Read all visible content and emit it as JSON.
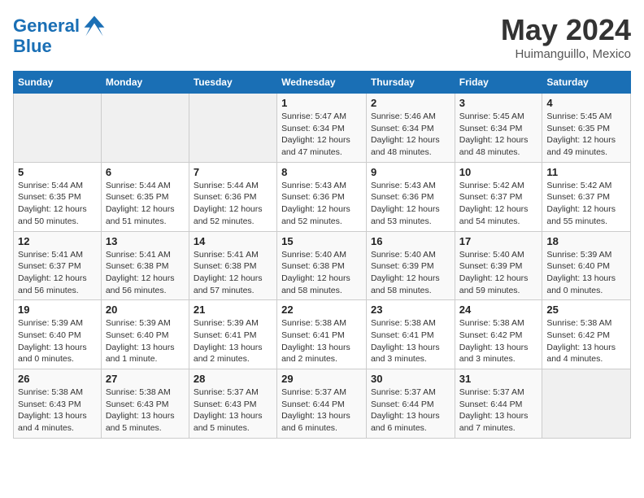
{
  "header": {
    "logo_line1": "General",
    "logo_line2": "Blue",
    "month": "May 2024",
    "location": "Huimanguillo, Mexico"
  },
  "weekdays": [
    "Sunday",
    "Monday",
    "Tuesday",
    "Wednesday",
    "Thursday",
    "Friday",
    "Saturday"
  ],
  "weeks": [
    [
      {
        "day": "",
        "info": ""
      },
      {
        "day": "",
        "info": ""
      },
      {
        "day": "",
        "info": ""
      },
      {
        "day": "1",
        "info": "Sunrise: 5:47 AM\nSunset: 6:34 PM\nDaylight: 12 hours\nand 47 minutes."
      },
      {
        "day": "2",
        "info": "Sunrise: 5:46 AM\nSunset: 6:34 PM\nDaylight: 12 hours\nand 48 minutes."
      },
      {
        "day": "3",
        "info": "Sunrise: 5:45 AM\nSunset: 6:34 PM\nDaylight: 12 hours\nand 48 minutes."
      },
      {
        "day": "4",
        "info": "Sunrise: 5:45 AM\nSunset: 6:35 PM\nDaylight: 12 hours\nand 49 minutes."
      }
    ],
    [
      {
        "day": "5",
        "info": "Sunrise: 5:44 AM\nSunset: 6:35 PM\nDaylight: 12 hours\nand 50 minutes."
      },
      {
        "day": "6",
        "info": "Sunrise: 5:44 AM\nSunset: 6:35 PM\nDaylight: 12 hours\nand 51 minutes."
      },
      {
        "day": "7",
        "info": "Sunrise: 5:44 AM\nSunset: 6:36 PM\nDaylight: 12 hours\nand 52 minutes."
      },
      {
        "day": "8",
        "info": "Sunrise: 5:43 AM\nSunset: 6:36 PM\nDaylight: 12 hours\nand 52 minutes."
      },
      {
        "day": "9",
        "info": "Sunrise: 5:43 AM\nSunset: 6:36 PM\nDaylight: 12 hours\nand 53 minutes."
      },
      {
        "day": "10",
        "info": "Sunrise: 5:42 AM\nSunset: 6:37 PM\nDaylight: 12 hours\nand 54 minutes."
      },
      {
        "day": "11",
        "info": "Sunrise: 5:42 AM\nSunset: 6:37 PM\nDaylight: 12 hours\nand 55 minutes."
      }
    ],
    [
      {
        "day": "12",
        "info": "Sunrise: 5:41 AM\nSunset: 6:37 PM\nDaylight: 12 hours\nand 56 minutes."
      },
      {
        "day": "13",
        "info": "Sunrise: 5:41 AM\nSunset: 6:38 PM\nDaylight: 12 hours\nand 56 minutes."
      },
      {
        "day": "14",
        "info": "Sunrise: 5:41 AM\nSunset: 6:38 PM\nDaylight: 12 hours\nand 57 minutes."
      },
      {
        "day": "15",
        "info": "Sunrise: 5:40 AM\nSunset: 6:38 PM\nDaylight: 12 hours\nand 58 minutes."
      },
      {
        "day": "16",
        "info": "Sunrise: 5:40 AM\nSunset: 6:39 PM\nDaylight: 12 hours\nand 58 minutes."
      },
      {
        "day": "17",
        "info": "Sunrise: 5:40 AM\nSunset: 6:39 PM\nDaylight: 12 hours\nand 59 minutes."
      },
      {
        "day": "18",
        "info": "Sunrise: 5:39 AM\nSunset: 6:40 PM\nDaylight: 13 hours\nand 0 minutes."
      }
    ],
    [
      {
        "day": "19",
        "info": "Sunrise: 5:39 AM\nSunset: 6:40 PM\nDaylight: 13 hours\nand 0 minutes."
      },
      {
        "day": "20",
        "info": "Sunrise: 5:39 AM\nSunset: 6:40 PM\nDaylight: 13 hours\nand 1 minute."
      },
      {
        "day": "21",
        "info": "Sunrise: 5:39 AM\nSunset: 6:41 PM\nDaylight: 13 hours\nand 2 minutes."
      },
      {
        "day": "22",
        "info": "Sunrise: 5:38 AM\nSunset: 6:41 PM\nDaylight: 13 hours\nand 2 minutes."
      },
      {
        "day": "23",
        "info": "Sunrise: 5:38 AM\nSunset: 6:41 PM\nDaylight: 13 hours\nand 3 minutes."
      },
      {
        "day": "24",
        "info": "Sunrise: 5:38 AM\nSunset: 6:42 PM\nDaylight: 13 hours\nand 3 minutes."
      },
      {
        "day": "25",
        "info": "Sunrise: 5:38 AM\nSunset: 6:42 PM\nDaylight: 13 hours\nand 4 minutes."
      }
    ],
    [
      {
        "day": "26",
        "info": "Sunrise: 5:38 AM\nSunset: 6:43 PM\nDaylight: 13 hours\nand 4 minutes."
      },
      {
        "day": "27",
        "info": "Sunrise: 5:38 AM\nSunset: 6:43 PM\nDaylight: 13 hours\nand 5 minutes."
      },
      {
        "day": "28",
        "info": "Sunrise: 5:37 AM\nSunset: 6:43 PM\nDaylight: 13 hours\nand 5 minutes."
      },
      {
        "day": "29",
        "info": "Sunrise: 5:37 AM\nSunset: 6:44 PM\nDaylight: 13 hours\nand 6 minutes."
      },
      {
        "day": "30",
        "info": "Sunrise: 5:37 AM\nSunset: 6:44 PM\nDaylight: 13 hours\nand 6 minutes."
      },
      {
        "day": "31",
        "info": "Sunrise: 5:37 AM\nSunset: 6:44 PM\nDaylight: 13 hours\nand 7 minutes."
      },
      {
        "day": "",
        "info": ""
      }
    ]
  ]
}
